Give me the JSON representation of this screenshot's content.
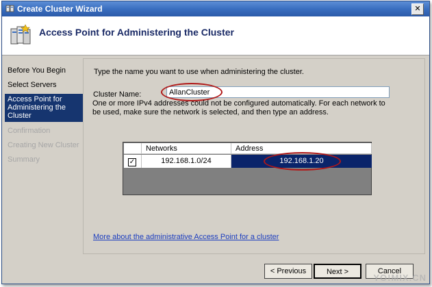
{
  "window": {
    "title": "Create Cluster Wizard"
  },
  "header": {
    "title": "Access Point for Administering the Cluster"
  },
  "sidebar": {
    "items": [
      {
        "label": "Before You Begin"
      },
      {
        "label": "Select Servers"
      },
      {
        "label": "Access Point for Administering the Cluster"
      },
      {
        "label": "Confirmation"
      },
      {
        "label": "Creating New Cluster"
      },
      {
        "label": "Summary"
      }
    ]
  },
  "main": {
    "instruction": "Type the name you want to use when administering the cluster.",
    "cluster_name_label": "Cluster Name:",
    "cluster_name_value": "AllanCluster",
    "description": "One or more IPv4 addresses could not be configured automatically.  For each network to be used, make sure the network is selected, and then type an address.",
    "grid": {
      "columns": [
        "Networks",
        "Address"
      ],
      "rows": [
        {
          "checked": true,
          "network": "192.168.1.0/24",
          "address": "192.168.1.20"
        }
      ]
    },
    "link": "More about the administrative Access Point for a cluster"
  },
  "buttons": {
    "previous": "< Previous",
    "next": "Next >",
    "cancel": "Cancel"
  },
  "colors": {
    "selection": "#0a246a",
    "sidebar_active": "#16356f",
    "annotation": "#b01818"
  }
}
